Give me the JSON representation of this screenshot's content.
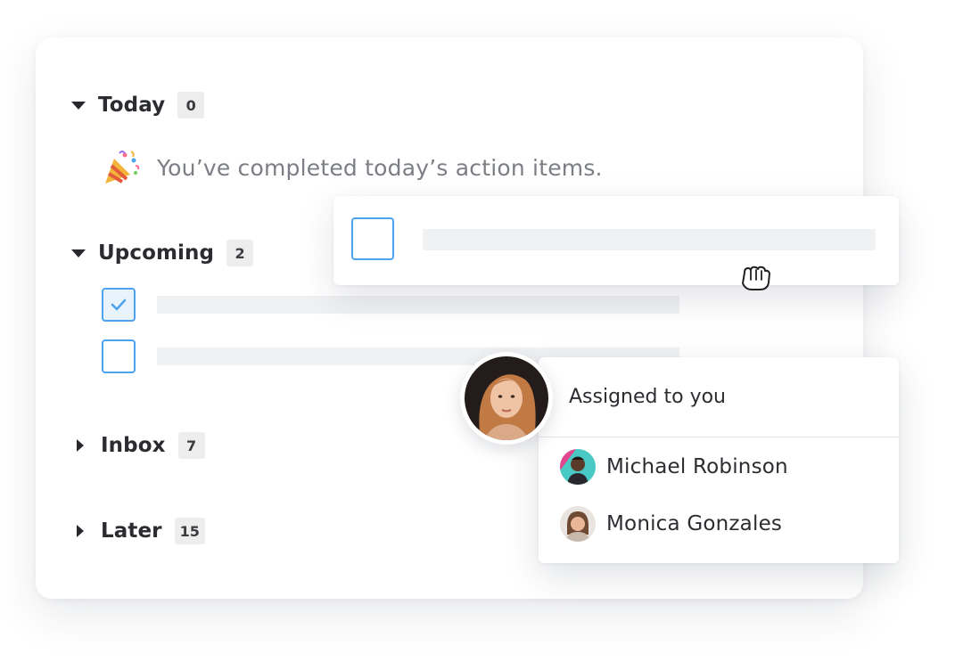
{
  "sections": {
    "today": {
      "title": "Today",
      "count": "0",
      "completed_message": "You’ve completed today’s action items."
    },
    "upcoming": {
      "title": "Upcoming",
      "count": "2"
    },
    "inbox": {
      "title": "Inbox",
      "count": "7"
    },
    "later": {
      "title": "Later",
      "count": "15"
    }
  },
  "assign_popup": {
    "title": "Assigned to you",
    "people": [
      {
        "name": "Michael Robinson"
      },
      {
        "name": "Monica Gonzales"
      }
    ]
  },
  "icons": {
    "party": "party-popper-icon",
    "cursor": "grab-hand-icon",
    "check": "checkmark-icon"
  },
  "colors": {
    "accent": "#4da3ee",
    "badge_bg": "#ededee",
    "muted_text": "#7b7e84"
  }
}
